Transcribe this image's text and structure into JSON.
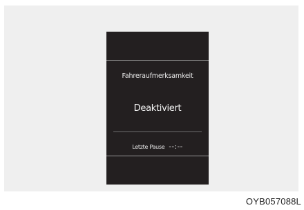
{
  "display": {
    "title": "Fahreraufmerksamkeit",
    "status": "Deaktiviert",
    "last_break_label": "Letzte Pause",
    "last_break_value": "--:--"
  },
  "figure": {
    "code": "OYB057088L"
  }
}
